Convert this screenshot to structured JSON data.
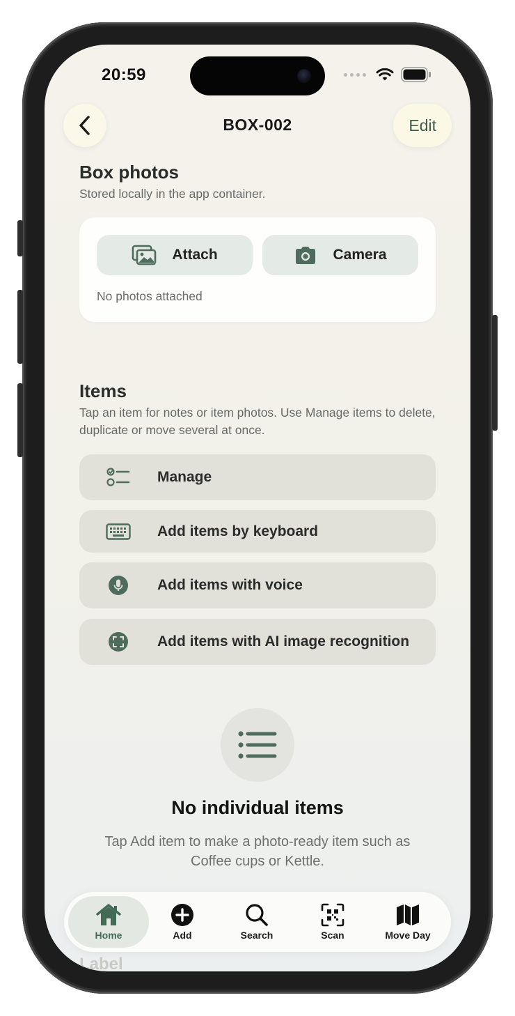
{
  "status_bar": {
    "time": "20:59"
  },
  "header": {
    "title": "BOX-002",
    "edit_label": "Edit"
  },
  "photos": {
    "title": "Box photos",
    "subtitle": "Stored locally in the app container.",
    "attach_label": "Attach",
    "camera_label": "Camera",
    "empty_text": "No photos attached"
  },
  "items": {
    "title": "Items",
    "subtitle": "Tap an item for notes or item photos. Use Manage items to delete, duplicate or move several at once.",
    "actions": [
      {
        "label": "Manage",
        "icon": "checklist-icon"
      },
      {
        "label": "Add items by keyboard",
        "icon": "keyboard-icon"
      },
      {
        "label": "Add items with voice",
        "icon": "microphone-icon"
      },
      {
        "label": "Add items with AI image recognition",
        "icon": "image-scan-icon"
      }
    ],
    "empty_title": "No individual items",
    "empty_text": "Tap Add item to make a photo-ready item such as Coffee cups or Kettle."
  },
  "next_section_label": "Label",
  "tabbar": {
    "tabs": [
      {
        "label": "Home",
        "icon": "house-icon",
        "active": true
      },
      {
        "label": "Add",
        "icon": "plus-circle-icon",
        "active": false
      },
      {
        "label": "Search",
        "icon": "magnifier-icon",
        "active": false
      },
      {
        "label": "Scan",
        "icon": "qr-scan-icon",
        "active": false
      },
      {
        "label": "Move Day",
        "icon": "map-icon",
        "active": false
      }
    ]
  },
  "colors": {
    "accent": "#416b55",
    "background": "#f4f2ea",
    "action_bg": "#e1e1da"
  }
}
